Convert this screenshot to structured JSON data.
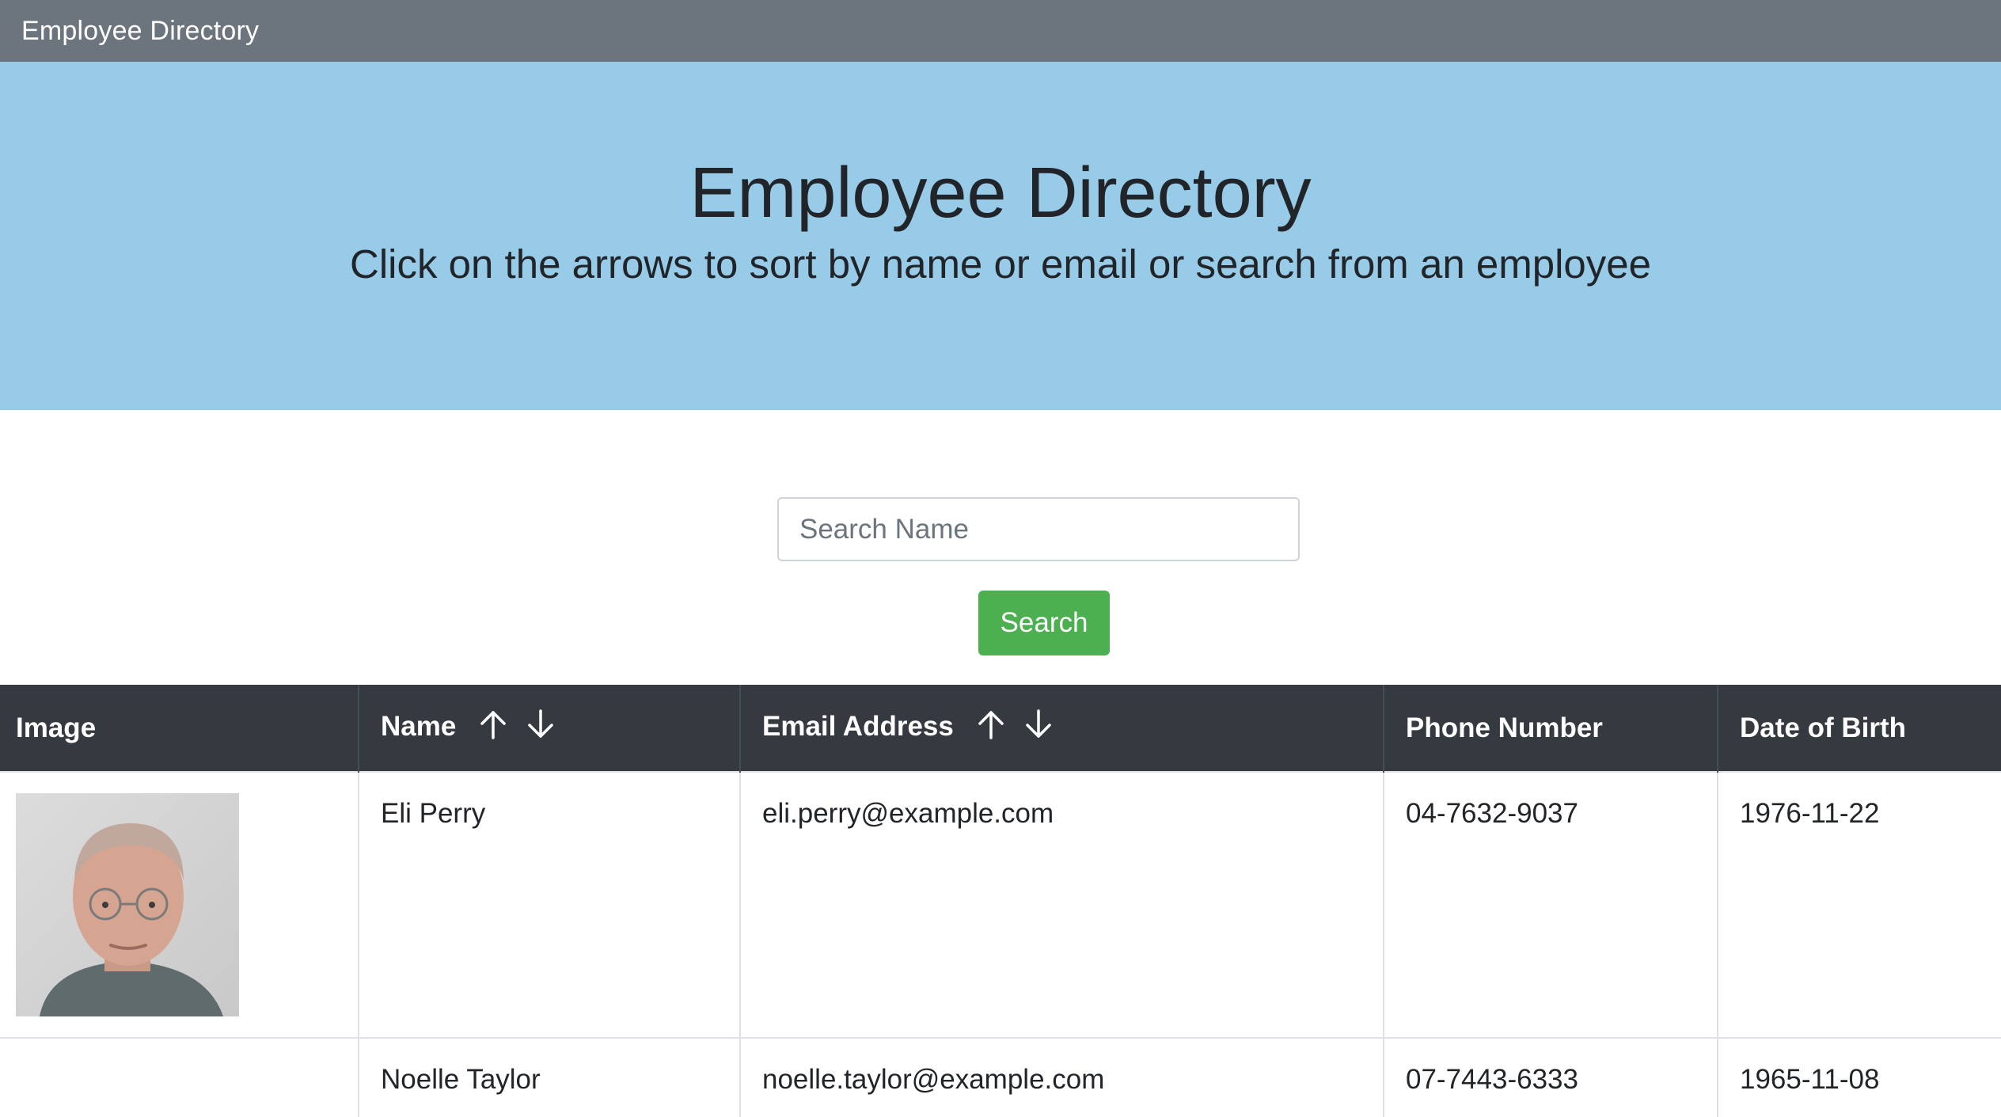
{
  "navbar": {
    "brand": "Employee Directory"
  },
  "header": {
    "title": "Employee Directory",
    "subtitle": "Click on the arrows to sort by name or email or search from an employee"
  },
  "search": {
    "placeholder": "Search Name",
    "value": "",
    "button_label": "Search"
  },
  "colors": {
    "navbar": "#6c757d",
    "jumbotron": "#97cbe8",
    "search_button": "#4caf50",
    "table_header": "#343a40"
  },
  "table": {
    "columns": [
      {
        "label": "Image",
        "sortable": false
      },
      {
        "label": "Name",
        "sortable": true
      },
      {
        "label": "Email Address",
        "sortable": true
      },
      {
        "label": "Phone Number",
        "sortable": false
      },
      {
        "label": "Date of Birth",
        "sortable": false
      }
    ],
    "rows": [
      {
        "image_icon": "person-photo",
        "name": "Eli Perry",
        "email": "eli.perry@example.com",
        "phone": "04-7632-9037",
        "dob": "1976-11-22"
      },
      {
        "image_icon": "person-photo",
        "name": "Noelle Taylor",
        "email": "noelle.taylor@example.com",
        "phone": "07-7443-6333",
        "dob": "1965-11-08"
      }
    ]
  }
}
